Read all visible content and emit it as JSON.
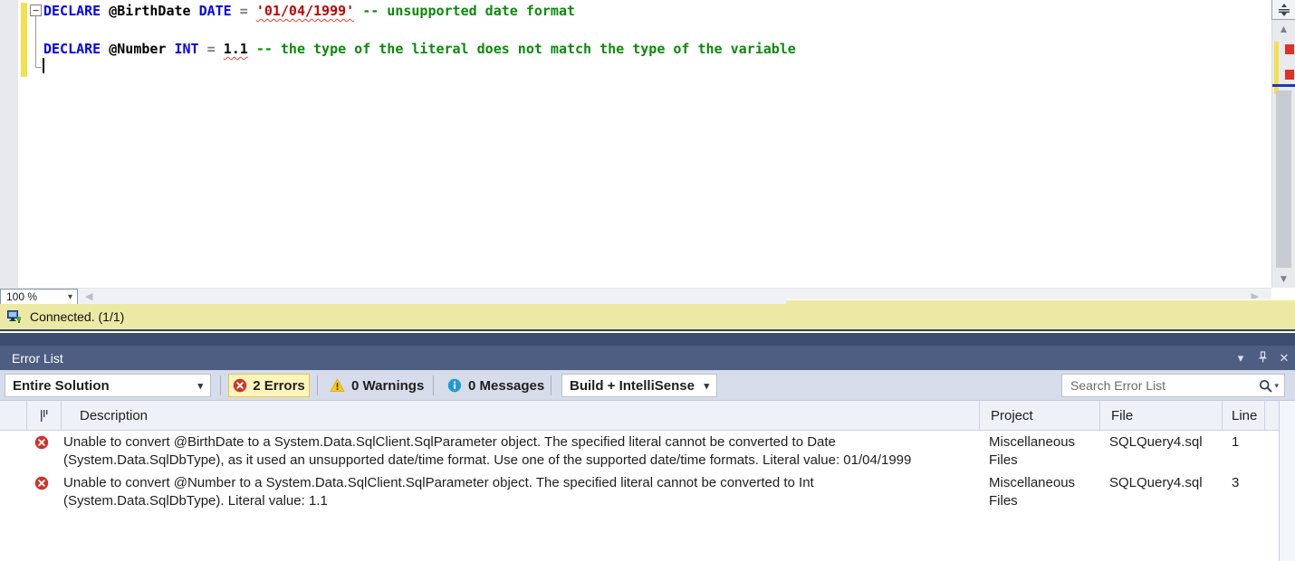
{
  "editor": {
    "fold_glyph": "−",
    "lines": [
      {
        "tokens": [
          {
            "text": "DECLARE "
          },
          {
            "text": "@BirthDate "
          },
          {
            "text": "DATE "
          },
          {
            "text": "= "
          },
          {
            "text": "'01/04/1999'"
          },
          {
            "text": " "
          },
          {
            "text": "-- unsupported date format"
          }
        ]
      },
      {
        "tokens": [
          {
            "text": "DECLARE "
          },
          {
            "text": "@Number "
          },
          {
            "text": "INT "
          },
          {
            "text": "= "
          },
          {
            "text": "1.1"
          },
          {
            "text": " "
          },
          {
            "text": "-- the type of the literal does not match the type of the variable"
          }
        ]
      }
    ],
    "zoom": {
      "value": "100 %"
    },
    "status": {
      "text": "Connected. (1/1)"
    }
  },
  "icons": {
    "dropdown": "▾",
    "close": "✕",
    "scroll_up": "▲",
    "scroll_down": "▼",
    "scroll_left": "◀",
    "scroll_right": "▶"
  },
  "error_list": {
    "title": "Error List",
    "toolbar": {
      "scope": "Entire Solution",
      "errors": "2 Errors",
      "warnings": "0 Warnings",
      "messages": "0 Messages",
      "filter": "Build + IntelliSense",
      "search_placeholder": "Search Error List"
    },
    "columns": {
      "description": "Description",
      "project": "Project",
      "file": "File",
      "line": "Line"
    },
    "rows": [
      {
        "description_line1": "Unable to convert @BirthDate to a System.Data.SqlClient.SqlParameter object. The specified literal cannot be converted to Date",
        "description_line2": "(System.Data.SqlDbType), as it used an unsupported date/time format. Use one of the supported date/time formats. Literal value: 01/04/1999",
        "project_line1": "Miscellaneous",
        "project_line2": "Files",
        "file": "SQLQuery4.sql",
        "line": "1"
      },
      {
        "description_line1": "Unable to convert @Number to a System.Data.SqlClient.SqlParameter object. The specified literal cannot be converted to Int",
        "description_line2": "(System.Data.SqlDbType). Literal value: 1.1",
        "project_line1": "Miscellaneous",
        "project_line2": "Files",
        "file": "SQLQuery4.sql",
        "line": "3"
      }
    ]
  },
  "colors": {
    "error_red": "#d23227",
    "warning_yellow": "#fdca12",
    "info_blue": "#1e9ad6",
    "status_yellow": "#ece9a4",
    "change_bar_yellow": "#f2e14c",
    "panel_title_blue": "#4d5e82"
  }
}
